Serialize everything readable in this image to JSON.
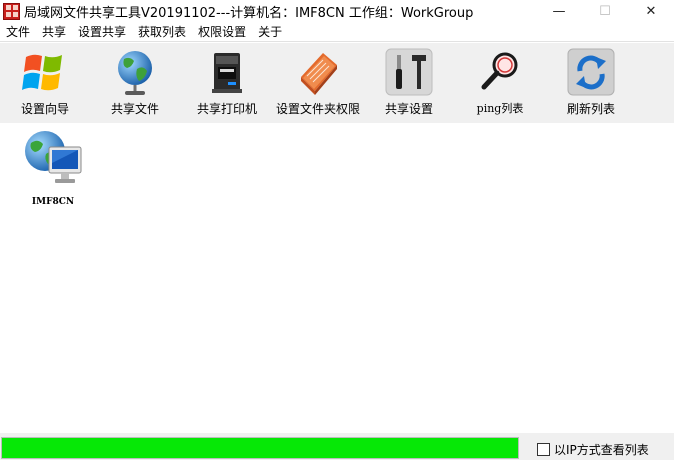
{
  "window": {
    "title": "局域网文件共享工具V20191102---计算机名：IMF8CN  工作组：WorkGroup",
    "minimize": "—",
    "maximize": "☐",
    "close": "✕"
  },
  "menu": [
    "文件",
    "共享",
    "设置共享",
    "获取列表",
    "权限设置",
    "关于"
  ],
  "toolbar": {
    "wizard": "设置向导",
    "share_files": "共享文件",
    "share_printer": "共享打印机",
    "folder_permissions": "设置文件夹权限",
    "share_settings": "共享设置",
    "ping_list": "ping列表",
    "refresh_list": "刷新列表"
  },
  "computers": [
    {
      "name": "IMF8CN"
    }
  ],
  "status": {
    "progress": 1.0,
    "progress_color": "#06e806",
    "ip_view_label": "以IP方式查看列表",
    "ip_view_checked": false
  }
}
